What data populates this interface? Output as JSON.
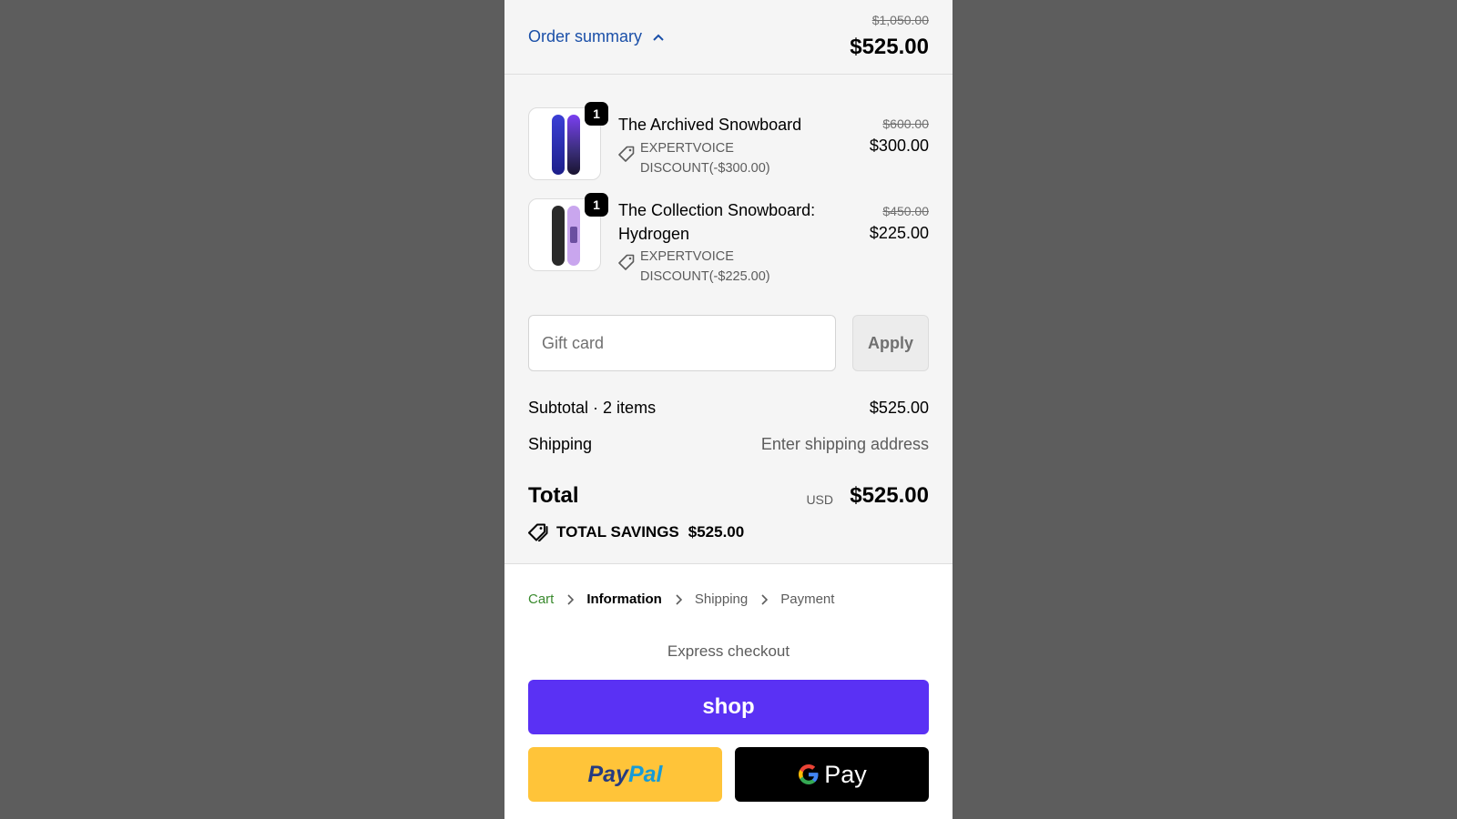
{
  "summary": {
    "toggle_label": "Order summary",
    "original_total": "$1,050.00",
    "total": "$525.00"
  },
  "items": [
    {
      "name": "The Archived Snowboard",
      "quantity": "1",
      "discount_line1": "EXPERTVOICE",
      "discount_line2": "DISCOUNT(-$300.00)",
      "original_price": "$600.00",
      "price": "$300.00"
    },
    {
      "name": "The Collection Snowboard: Hydrogen",
      "quantity": "1",
      "discount_line1": "EXPERTVOICE",
      "discount_line2": "DISCOUNT(-$225.00)",
      "original_price": "$450.00",
      "price": "$225.00"
    }
  ],
  "gift_card": {
    "placeholder": "Gift card",
    "value": "",
    "apply_label": "Apply"
  },
  "subtotal": {
    "label": "Subtotal · 2 items",
    "value": "$525.00"
  },
  "shipping": {
    "label": "Shipping",
    "value": "Enter shipping address"
  },
  "total": {
    "label": "Total",
    "currency": "USD",
    "value": "$525.00"
  },
  "savings": {
    "label": "TOTAL SAVINGS",
    "value": "$525.00"
  },
  "breadcrumb": {
    "cart": "Cart",
    "information": "Information",
    "shipping": "Shipping",
    "payment": "Payment"
  },
  "express": {
    "heading": "Express checkout",
    "shop_label": "shop",
    "paypal_part1": "Pay",
    "paypal_part2": "Pal",
    "gpay_label": "Pay"
  },
  "colors": {
    "link_blue": "#1a4fa8",
    "shop_purple": "#5a31f4",
    "paypal_yellow": "#ffc439",
    "breadcrumb_green": "#3a8a2e"
  }
}
